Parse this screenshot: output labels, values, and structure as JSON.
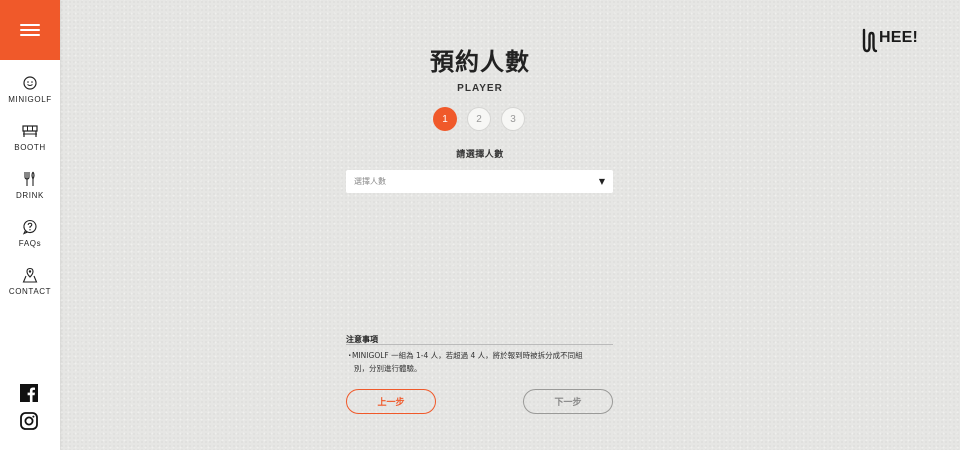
{
  "sidebar": {
    "menu_icon": "hamburger-icon",
    "items": [
      {
        "label": "MINIGOLF",
        "icon": "smiley-icon"
      },
      {
        "label": "BOOTH",
        "icon": "booth-icon"
      },
      {
        "label": "DRINK",
        "icon": "cutlery-icon"
      },
      {
        "label": "FAQs",
        "icon": "question-bubble-icon"
      },
      {
        "label": "CONTACT",
        "icon": "map-pin-icon"
      }
    ],
    "social": [
      {
        "icon": "facebook-icon"
      },
      {
        "icon": "instagram-icon"
      }
    ]
  },
  "brand": {
    "logo_text": "HEE!"
  },
  "page": {
    "title": "預約人數",
    "subtitle": "PLAYER",
    "steps": [
      "1",
      "2",
      "3"
    ],
    "active_step": 1,
    "prompt": "請選擇人數",
    "select": {
      "placeholder": "選擇人數",
      "arrow": "▼"
    },
    "notice": {
      "title": "注意事項",
      "bullet": "・",
      "line1": "MINIGOLF 一組為 1-4 人，若超過 4 人，將於報到時被拆分成不同組",
      "line2": "別，分別進行體驗。"
    },
    "prev_label": "上一步",
    "next_label": "下一步"
  },
  "colors": {
    "accent": "#f0592a",
    "background": "#e6e6e4",
    "sidebar": "#ffffff"
  }
}
